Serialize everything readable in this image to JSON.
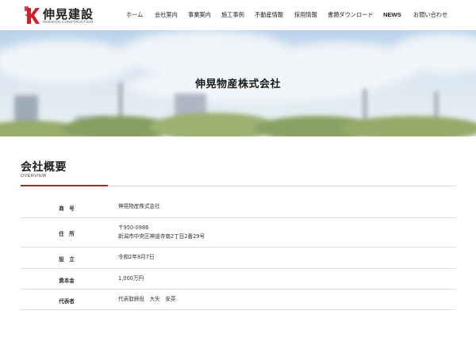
{
  "header": {
    "logo": {
      "name": "伸晃建設",
      "sub": "SHINKOH CONSTRUCTION",
      "mark_color": "#c8232a"
    },
    "nav": [
      {
        "label": "ホーム"
      },
      {
        "label": "会社案内"
      },
      {
        "label": "事業案内"
      },
      {
        "label": "施工事例"
      },
      {
        "label": "不動産情報"
      },
      {
        "label": "採用情報"
      },
      {
        "label": "書類ダウンロード"
      },
      {
        "label": "NEWS"
      },
      {
        "label": "お問い合わせ"
      }
    ]
  },
  "hero": {
    "title": "伸晃物産株式会社"
  },
  "section": {
    "title": "会社概要",
    "subtitle": "OVERVIEW",
    "accent_color": "#b02a2a"
  },
  "table": {
    "rows": [
      {
        "label": "商　号",
        "lines": [
          "伸晃物産株式会社"
        ]
      },
      {
        "label": "住　所",
        "lines": [
          "〒950-0986",
          "新潟市中央区神道寺南2丁目2番29号"
        ]
      },
      {
        "label": "設　立",
        "lines": [
          "令和2年8月7日"
        ]
      },
      {
        "label": "資本金",
        "lines": [
          "1,000万円"
        ]
      },
      {
        "label": "代表者",
        "lines": [
          "代表取締役　大矢　安英"
        ]
      }
    ]
  }
}
